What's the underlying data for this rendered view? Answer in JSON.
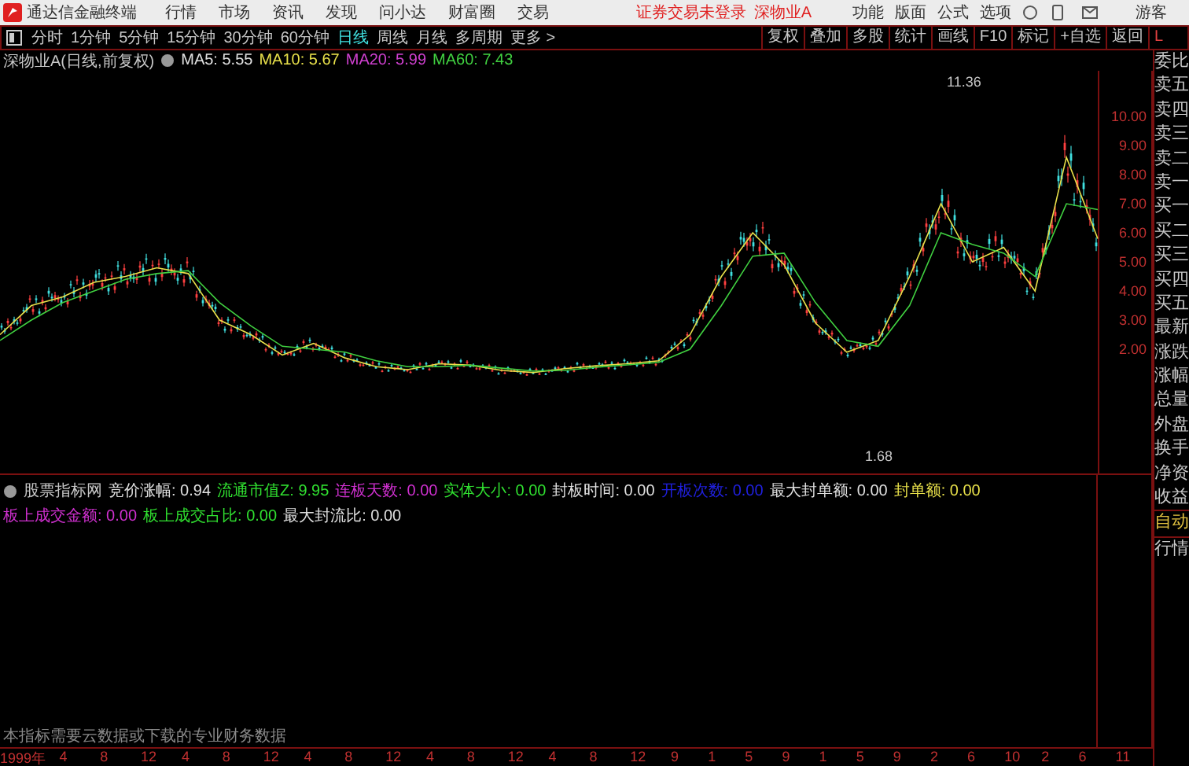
{
  "menu_bar": {
    "app_title": "通达信金融终端",
    "menus": [
      "行情",
      "市场",
      "资讯",
      "发现",
      "问小达",
      "财富圈",
      "交易"
    ],
    "login_status": "证券交易未登录",
    "stock": "深物业A",
    "tools": [
      "功能",
      "版面",
      "公式",
      "选项"
    ],
    "user": "游客"
  },
  "period_tabs": [
    {
      "label": "分时",
      "selected": false
    },
    {
      "label": "1分钟",
      "selected": false
    },
    {
      "label": "5分钟",
      "selected": false
    },
    {
      "label": "15分钟",
      "selected": false
    },
    {
      "label": "30分钟",
      "selected": false
    },
    {
      "label": "60分钟",
      "selected": false
    },
    {
      "label": "日线",
      "selected": true
    },
    {
      "label": "周线",
      "selected": false
    },
    {
      "label": "月线",
      "selected": false
    },
    {
      "label": "多周期",
      "selected": false
    },
    {
      "label": "更多 >",
      "selected": false
    }
  ],
  "chart_tools": [
    "复权",
    "叠加",
    "多股",
    "统计",
    "画线",
    "F10",
    "标记",
    "+自选",
    "返回"
  ],
  "legend": {
    "title": "深物业A(日线,前复权)",
    "items": [
      {
        "text": "MA5: 5.55",
        "color": "#e0e0e0"
      },
      {
        "text": "MA10: 5.67",
        "color": "#e8e04a"
      },
      {
        "text": "MA20: 5.99",
        "color": "#d040d0"
      },
      {
        "text": "MA60: 7.43",
        "color": "#40d040"
      }
    ]
  },
  "price_chart": {
    "chart_data": {
      "type": "line",
      "ylim": [
        -2.27,
        11.57
      ],
      "yticks": [
        {
          "value": 10,
          "label": "10.00"
        },
        {
          "value": 9,
          "label": "9.00"
        },
        {
          "value": 8,
          "label": "8.00"
        },
        {
          "value": 7,
          "label": "7.00"
        },
        {
          "value": 6,
          "label": "6.00"
        },
        {
          "value": 5,
          "label": "5.00"
        },
        {
          "value": 4,
          "label": "4.00"
        },
        {
          "value": 3,
          "label": "3.00"
        },
        {
          "value": 2,
          "label": "2.00"
        }
      ],
      "series": [
        {
          "color": "#e8e04a",
          "values": [
            2.5,
            3.5,
            3.8,
            4.3,
            4.5,
            4.8,
            4.6,
            3.0,
            2.5,
            1.8,
            2.2,
            1.7,
            1.4,
            1.3,
            1.5,
            1.45,
            1.27,
            1.2,
            1.33,
            1.43,
            1.5,
            1.6,
            2.5,
            4.5,
            6.0,
            4.9,
            2.9,
            1.9,
            2.3,
            4.5,
            7.0,
            5.0,
            5.5,
            4.0,
            8.6,
            5.8
          ]
        },
        {
          "color": "#40d040",
          "values": [
            2.3,
            3.0,
            3.6,
            4.0,
            4.4,
            4.6,
            4.7,
            3.6,
            2.8,
            2.1,
            2.0,
            1.9,
            1.6,
            1.4,
            1.4,
            1.45,
            1.35,
            1.25,
            1.27,
            1.38,
            1.46,
            1.55,
            2.0,
            3.5,
            5.2,
            5.3,
            3.6,
            2.3,
            2.1,
            3.5,
            6.0,
            5.6,
            5.3,
            4.5,
            7.0,
            6.8
          ]
        }
      ]
    }
  },
  "annotations": {
    "high": "11.36",
    "low": "1.68"
  },
  "sidebar": {
    "header": "L",
    "items": [
      "委比",
      "卖五",
      "卖四",
      "卖三",
      "卖二",
      "卖一",
      "买一",
      "买二",
      "买三",
      "买四",
      "买五",
      "最新",
      "涨跌",
      "涨幅",
      "总量",
      "外盘",
      "换手",
      "净资",
      "收益"
    ],
    "buttons": [
      "自动",
      "行情"
    ]
  },
  "indicator": {
    "name": "股票指标网",
    "items": [
      {
        "text": "竞价涨幅: 0.94",
        "color": "#e0e0e0"
      },
      {
        "text": "流通市值Z: 9.95",
        "color": "#30e030"
      },
      {
        "text": "连板天数: 0.00",
        "color": "#d030d0"
      },
      {
        "text": "实体大小: 0.00",
        "color": "#30e030"
      },
      {
        "text": "封板时间: 0.00",
        "color": "#e0e0e0"
      },
      {
        "text": "开板次数: 0.00",
        "color": "#2020e0"
      },
      {
        "text": "最大封单额: 0.00",
        "color": "#e0e0e0"
      },
      {
        "text": "封单额: 0.00",
        "color": "#e8e04a"
      },
      {
        "text": "板上成交金额: 0.00",
        "color": "#d030d0"
      },
      {
        "text": "板上成交占比: 0.00",
        "color": "#30e030"
      },
      {
        "text": "最大封流比: 0.00",
        "color": "#e0e0e0"
      }
    ],
    "note": "本指标需要云数据或下载的专业财务数据"
  },
  "date_axis": [
    "1999年",
    "4",
    "8",
    "12",
    "4",
    "8",
    "12",
    "4",
    "8",
    "12",
    "4",
    "8",
    "12",
    "4",
    "8",
    "12",
    "9",
    "1",
    "5",
    "9",
    "1",
    "5",
    "9",
    "2",
    "6",
    "10",
    "2",
    "6",
    "11"
  ]
}
